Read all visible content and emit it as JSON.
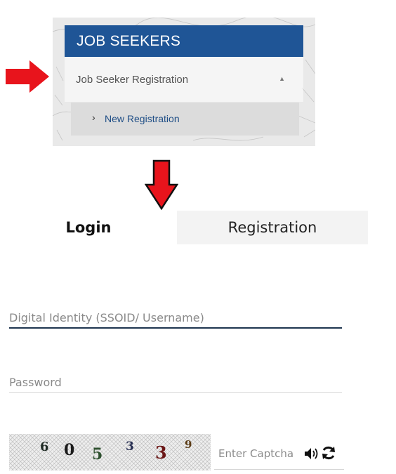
{
  "menu": {
    "header": "JOB SEEKERS",
    "group_label": "Job Seeker Registration",
    "caret_icon": "caret-up-icon",
    "subitem_chevron": "›",
    "subitem_label": "New Registration"
  },
  "arrows": {
    "left_arrow_icon": "arrow-right-icon",
    "down_arrow_icon": "arrow-down-icon",
    "color": "#e8141c"
  },
  "tabs": {
    "login_label": "Login",
    "registration_label": "Registration"
  },
  "form": {
    "ssoid_placeholder": "Digital Identity (SSOID/ Username)",
    "password_placeholder": "Password",
    "captcha_placeholder": "Enter Captcha",
    "captcha_digits": [
      {
        "char": "6",
        "color": "#1e2a24"
      },
      {
        "char": "0",
        "color": "#1b1b1b"
      },
      {
        "char": "5",
        "color": "#2f5130"
      },
      {
        "char": "3",
        "color": "#262e52"
      },
      {
        "char": "3",
        "color": "#6b1616"
      },
      {
        "char": "9",
        "color": "#5a3a14"
      }
    ],
    "audio_icon": "speaker-icon",
    "refresh_icon": "refresh-icon"
  },
  "colors": {
    "header_blue": "#1f5596",
    "link_blue": "#1f4e86",
    "active_underline": "#1e3550"
  }
}
